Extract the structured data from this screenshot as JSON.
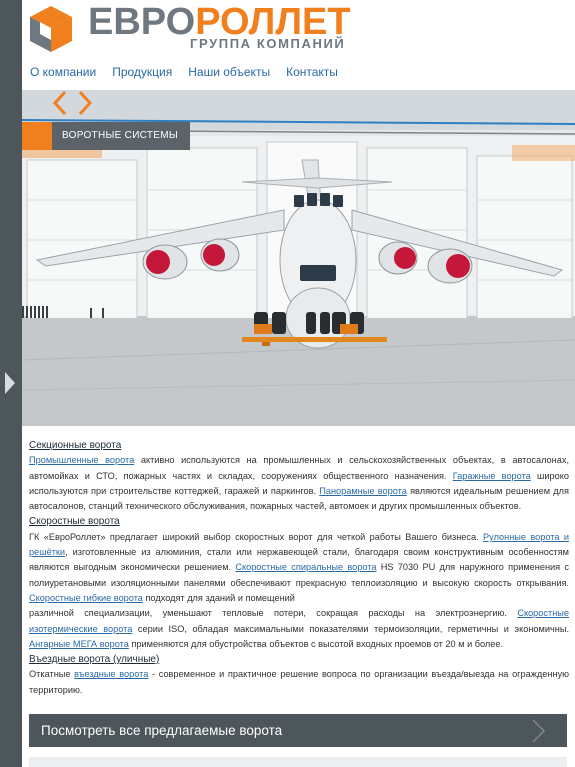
{
  "brand": {
    "name_part1": "ЕВРО",
    "name_part2": "РОЛЛЕТ",
    "subtitle": "ГРУППА КОМПАНИЙ",
    "color_orange": "#f07f1e",
    "color_gray": "#6f7880"
  },
  "nav": {
    "items": [
      "О компании",
      "Продукция",
      "Наши объекты",
      "Контакты"
    ]
  },
  "hero": {
    "label": "ВОРОТНЫЕ СИСТЕМЫ",
    "prev_icon": "chevron-left-icon",
    "next_icon": "chevron-right-icon"
  },
  "sections": {
    "sectional": {
      "heading": "Секционные ворота",
      "link1": "Промышленные ворота",
      "text1": " активно используются на промышленных и сельскохозяйственных объектах, в автосалонах, автомойках и СТО, пожарных частях и складах, сооружениях общественного назначения. ",
      "link2": "Гаражные ворота",
      "text2": " широко используются при строительстве коттеджей, гаражей и паркингов. ",
      "link3": "Панорамные ворота",
      "text3": " являются идеальным решением для автосалонов, станций технического обслуживания, пожарных частей, автомоек и других промышленных объектов."
    },
    "speed": {
      "heading": "Скоростные ворота",
      "text1": "ГК «ЕвроРоллет» предлагает широкий выбор скоростных ворот для четкой работы Вашего бизнеса. ",
      "link1": "Рулонные ворота и решётки",
      "text2": ", изготовленные из алюминия, стали или нержавеющей стали, благодаря своим конструктивным особенностям являются выгодным экономически решением. ",
      "link2": "Скоростные спиральные ворота",
      "text3": " HS 7030 PU для наружного применения с полиуретановыми изоляционными панелями обеспечивают прекрасную теплоизоляцию и высокую скорость открывания. ",
      "link3": "Скоростные гибкие ворота",
      "text4": " подходят для зданий и помещений",
      "text5": "различной специализации, уменьшают тепловые потери, сокращая расходы на электроэнергию. ",
      "link4": "Скоростные изотермические ворота",
      "text6": " серии ISO, обладая максимальными показателями термоизоляции, герметичны и экономичны. ",
      "link5": "Ангарные МЕГА ворота",
      "text7": " применяются для обустройства объектов с высотой входных проемов от 20 м и более."
    },
    "entry": {
      "heading": "Въездные ворота (уличные)",
      "text1": "Откатные ",
      "link1": "въездные ворота",
      "text2": " - современное и практичное решение вопроса по организации въезда/выезда на огражденную территорию."
    }
  },
  "cta": {
    "label": "Посмотреть все предлагаемые ворота",
    "icon": "chevron-right-icon"
  }
}
